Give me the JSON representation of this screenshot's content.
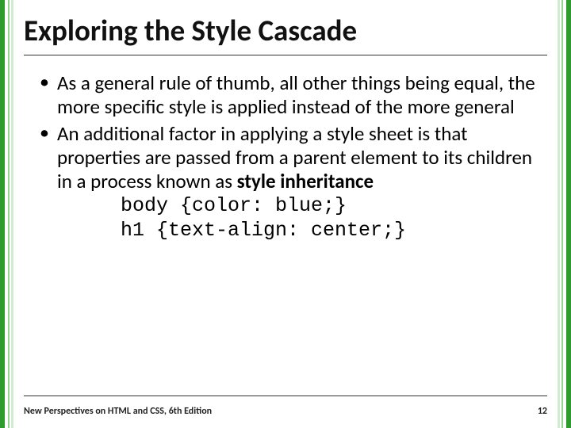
{
  "title": "Exploring the Style Cascade",
  "bullets": [
    {
      "marker": "•",
      "text": "As a general rule of thumb, all other things being equal, the more specific style is applied instead of the more general"
    },
    {
      "marker": "•",
      "text_pre": "An additional factor in applying a style sheet is that properties are passed from a parent element to its children in a process known as ",
      "text_bold": "style inheritance"
    }
  ],
  "code_lines": [
    "body {color: blue;}",
    "h1 {text-align: center;}"
  ],
  "footer": {
    "left": "New Perspectives on HTML and CSS, 6th Edition",
    "right": "12"
  }
}
